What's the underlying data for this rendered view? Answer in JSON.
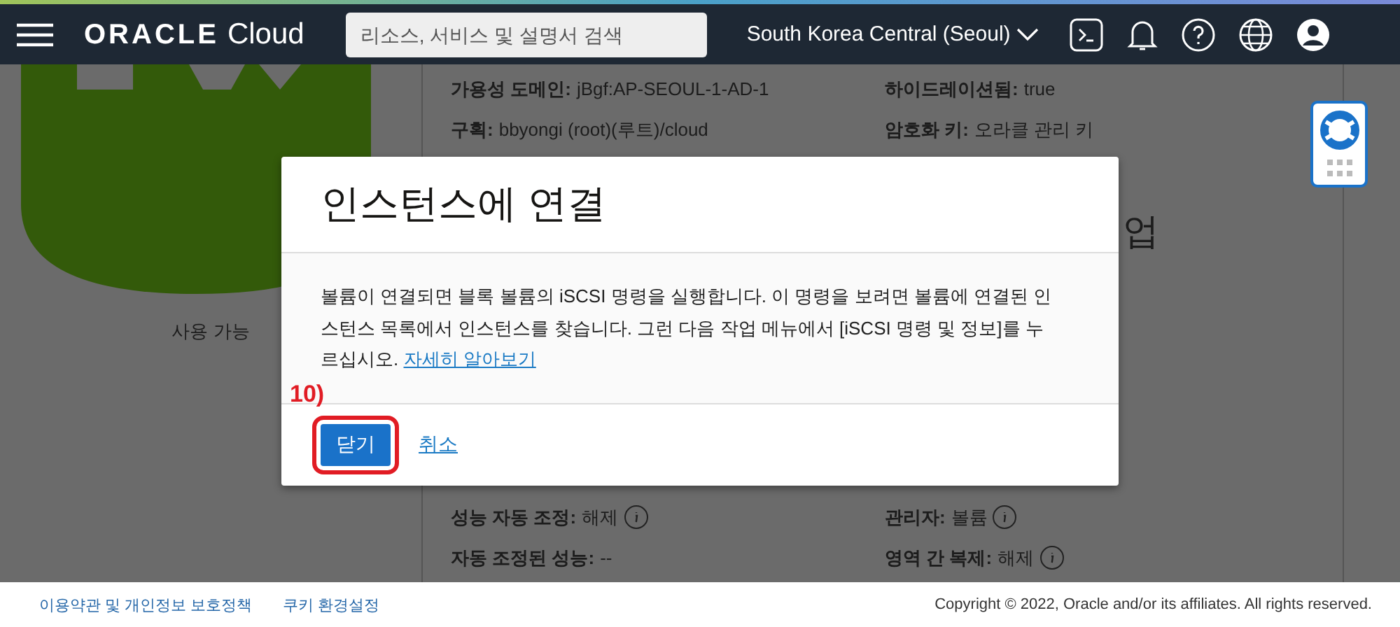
{
  "header": {
    "logo": {
      "brand": "ORACLE",
      "product": "Cloud"
    },
    "search": {
      "placeholder": "리소스, 서비스 및 설명서 검색"
    },
    "region": "South Korea Central (Seoul)"
  },
  "volume": {
    "status": "사용 가능"
  },
  "details_top": [
    {
      "label": "가용성 도메인:",
      "value": "jBgf:AP-SEOUL-1-AD-1"
    },
    {
      "label": "하이드레이션됨:",
      "value": "true"
    },
    {
      "label": "구획:",
      "value": "bbyongi (root)(루트)/cloud"
    },
    {
      "label": "암호화 키:",
      "value": "오라클 관리 키"
    }
  ],
  "section_heading_fragment": "업",
  "details_bottom": [
    {
      "label": "성능 자동 조정:",
      "value": "해제",
      "kind": "info"
    },
    {
      "label": "관리자:",
      "value": "볼륨",
      "kind": "info"
    },
    {
      "label": "자동 조정된 성능:",
      "value": "--",
      "kind": "plain"
    },
    {
      "label": "영역 간 복제:",
      "value": "해제",
      "kind": "info"
    }
  ],
  "dialog": {
    "title": "인스턴스에 연결",
    "body": "볼륨이 연결되면 블록 볼륨의 iSCSI 명령을 실행합니다. 이 명령을 보려면 볼륨에 연결된 인스턴스 목록에서 인스턴스를 찾습니다. 그런 다음 작업 메뉴에서 [iSCSI 명령 및 정보]를 누르십시오.",
    "link": "자세히 알아보기",
    "primary_button": "닫기",
    "cancel_link": "취소"
  },
  "annotation": {
    "label": "10)"
  },
  "footer": {
    "links": [
      "이용약관 및 개인정보 보호정책",
      "쿠키 환경설정"
    ],
    "copyright": "Copyright © 2022, Oracle and/or its affiliates. All rights reserved."
  }
}
